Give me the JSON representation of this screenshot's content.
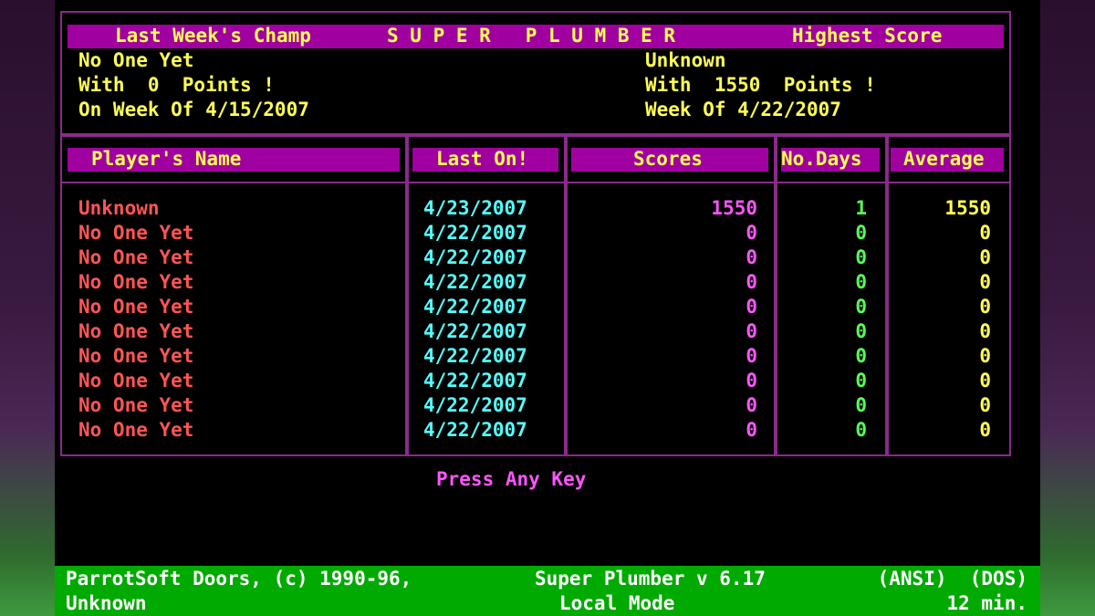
{
  "header": {
    "left_label": "Last Week's Champ",
    "title": "S U P E R   P L U M B E R",
    "right_label": "Highest Score"
  },
  "champ": {
    "name": "No One Yet",
    "points_line": "With  0  Points !",
    "week_line": "On Week Of 4/15/2007"
  },
  "highest": {
    "name": "Unknown",
    "points_line": "With  1550  Points !",
    "week_line": "Week Of 4/22/2007"
  },
  "columns": {
    "name": "Player's Name",
    "last_on": "Last On!",
    "scores": "Scores",
    "days": "No.Days",
    "average": "Average"
  },
  "rows": [
    {
      "name": "Unknown",
      "last_on": "4/23/2007",
      "score": "1550",
      "days": "1",
      "average": "1550"
    },
    {
      "name": "No One Yet",
      "last_on": "4/22/2007",
      "score": "0",
      "days": "0",
      "average": "0"
    },
    {
      "name": "No One Yet",
      "last_on": "4/22/2007",
      "score": "0",
      "days": "0",
      "average": "0"
    },
    {
      "name": "No One Yet",
      "last_on": "4/22/2007",
      "score": "0",
      "days": "0",
      "average": "0"
    },
    {
      "name": "No One Yet",
      "last_on": "4/22/2007",
      "score": "0",
      "days": "0",
      "average": "0"
    },
    {
      "name": "No One Yet",
      "last_on": "4/22/2007",
      "score": "0",
      "days": "0",
      "average": "0"
    },
    {
      "name": "No One Yet",
      "last_on": "4/22/2007",
      "score": "0",
      "days": "0",
      "average": "0"
    },
    {
      "name": "No One Yet",
      "last_on": "4/22/2007",
      "score": "0",
      "days": "0",
      "average": "0"
    },
    {
      "name": "No One Yet",
      "last_on": "4/22/2007",
      "score": "0",
      "days": "0",
      "average": "0"
    },
    {
      "name": "No One Yet",
      "last_on": "4/22/2007",
      "score": "0",
      "days": "0",
      "average": "0"
    }
  ],
  "prompt": "Press Any Key",
  "status": {
    "left_top": "ParrotSoft Doors, (c) 1990-96,",
    "center_top": "Super Plumber v 6.17",
    "right_top": "(ANSI)  (DOS)",
    "left_bottom": "Unknown",
    "center_bottom": "Local Mode",
    "right_bottom": "12 min."
  },
  "colors": {
    "frame": "#8a2a8a",
    "bar": "#a000a0",
    "header_text": "#ffff55",
    "name_text": "#ff5555",
    "date_text": "#55ffff",
    "score_text": "#ff55ff",
    "days_text": "#55ff55",
    "status_bar": "#00aa00"
  }
}
